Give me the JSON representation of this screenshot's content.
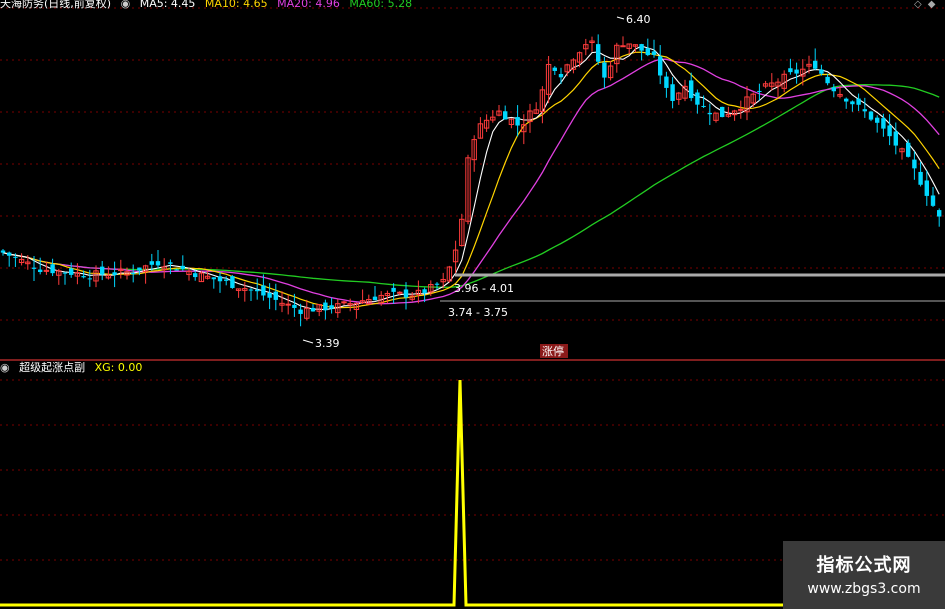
{
  "main_panel": {
    "title": "天海防务(日线,前复权)",
    "indicators": [
      {
        "label": "MA5: 4.45",
        "color": "#ffffff"
      },
      {
        "label": "MA10: 4.65",
        "color": "#ffd400"
      },
      {
        "label": "MA20: 4.96",
        "color": "#e040e0"
      },
      {
        "label": "MA60: 5.28",
        "color": "#22cc22"
      }
    ],
    "annotations": {
      "high_label": "6.40",
      "low_label": "3.39",
      "zone_upper": "3.96 - 4.01",
      "zone_lower": "3.74 - 3.75",
      "limit_up_tag": "涨停"
    }
  },
  "sub_panel": {
    "title": "超级起涨点副",
    "xg_label": "XG: 0.00"
  },
  "watermark": {
    "line1": "指标公式网",
    "line2": "www.zbgs3.com"
  },
  "colors": {
    "up": "#ff3c3c",
    "down": "#00d8ff",
    "ma5": "#ffffff",
    "ma10": "#ffd400",
    "ma20": "#e040e0",
    "ma60": "#22cc22",
    "signal": "#ffff00",
    "grid": "#7a0000"
  },
  "chart_data": {
    "type": "candlestick",
    "series": [
      {
        "name": "MA5",
        "value": 4.45
      },
      {
        "name": "MA10",
        "value": 4.65
      },
      {
        "name": "MA20",
        "value": 4.96
      },
      {
        "name": "MA60",
        "value": 5.28
      }
    ],
    "price_high": 6.4,
    "price_low": 3.39,
    "last_close": 4.45,
    "price_range": [
      3.3,
      6.5
    ],
    "sub_indicator": {
      "name": "XG",
      "last_value": 0.0,
      "spike_value": 1,
      "spike_position": 0.49
    }
  }
}
